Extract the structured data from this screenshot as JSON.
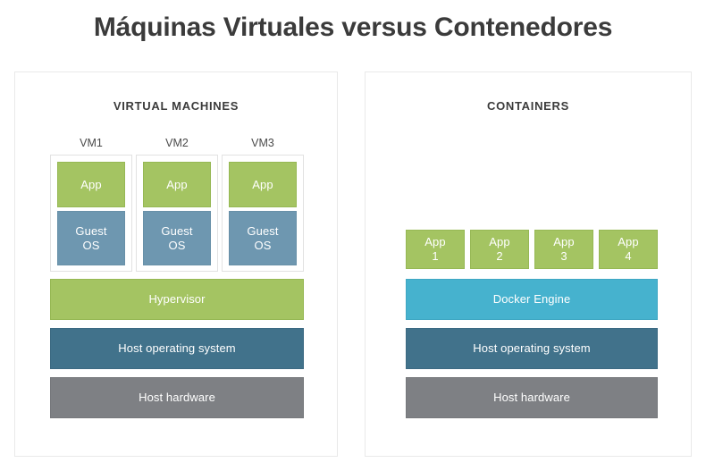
{
  "title": "Máquinas Virtuales versus Contenedores",
  "colors": {
    "app_green": "#a4c462",
    "guest_os_blue": "#6e97b0",
    "host_os_blue": "#41728b",
    "hardware_gray": "#7e8084",
    "docker_blue": "#46b2ce",
    "title_text": "#3b3b3b",
    "panel_border": "#e9e9e9"
  },
  "vm_panel": {
    "heading": "VIRTUAL MACHINES",
    "vms": [
      {
        "label": "VM1",
        "app": "App",
        "guest_os": "Guest\nOS"
      },
      {
        "label": "VM2",
        "app": "App",
        "guest_os": "Guest\nOS"
      },
      {
        "label": "VM3",
        "app": "App",
        "guest_os": "Guest\nOS"
      }
    ],
    "layers": [
      {
        "label": "Hypervisor"
      },
      {
        "label": "Host operating system"
      },
      {
        "label": "Host hardware"
      }
    ]
  },
  "containers_panel": {
    "heading": "CONTAINERS",
    "apps": [
      {
        "label": "App\n1"
      },
      {
        "label": "App\n2"
      },
      {
        "label": "App\n3"
      },
      {
        "label": "App\n4"
      }
    ],
    "layers": [
      {
        "label": "Docker Engine"
      },
      {
        "label": "Host operating system"
      },
      {
        "label": "Host hardware"
      }
    ]
  }
}
